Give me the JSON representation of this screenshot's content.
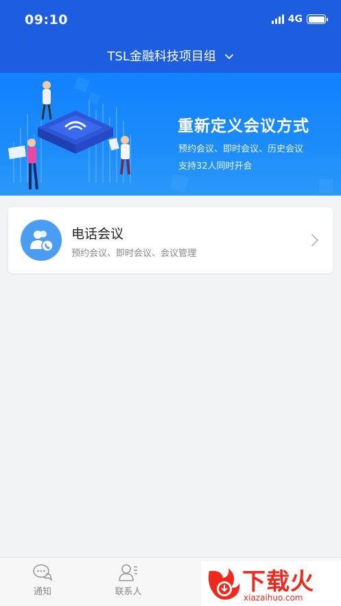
{
  "status_bar": {
    "time": "09:10",
    "network": "4G"
  },
  "header": {
    "group_title": "TSL金融科技项目组"
  },
  "banner": {
    "title": "重新定义会议方式",
    "line1": "预约会议、即时会议、历史会议",
    "line2": "支持32人同时开会"
  },
  "card": {
    "title": "电话会议",
    "subtitle": "预约会议、即时会议、会议管理",
    "icon": "phone-contacts-icon"
  },
  "tabbar": {
    "tabs": [
      {
        "label": "通知",
        "icon": "chat-bubble-icon"
      },
      {
        "label": "联系人",
        "icon": "contact-icon"
      }
    ]
  },
  "watermark": {
    "text": "下载火",
    "url": "xiazaihuo.com"
  },
  "colors": {
    "header_blue": "#1d5ee0",
    "banner_blue": "#1c8cfa",
    "card_icon_blue": "#4a9df2",
    "watermark_red": "#ee2a1f"
  }
}
